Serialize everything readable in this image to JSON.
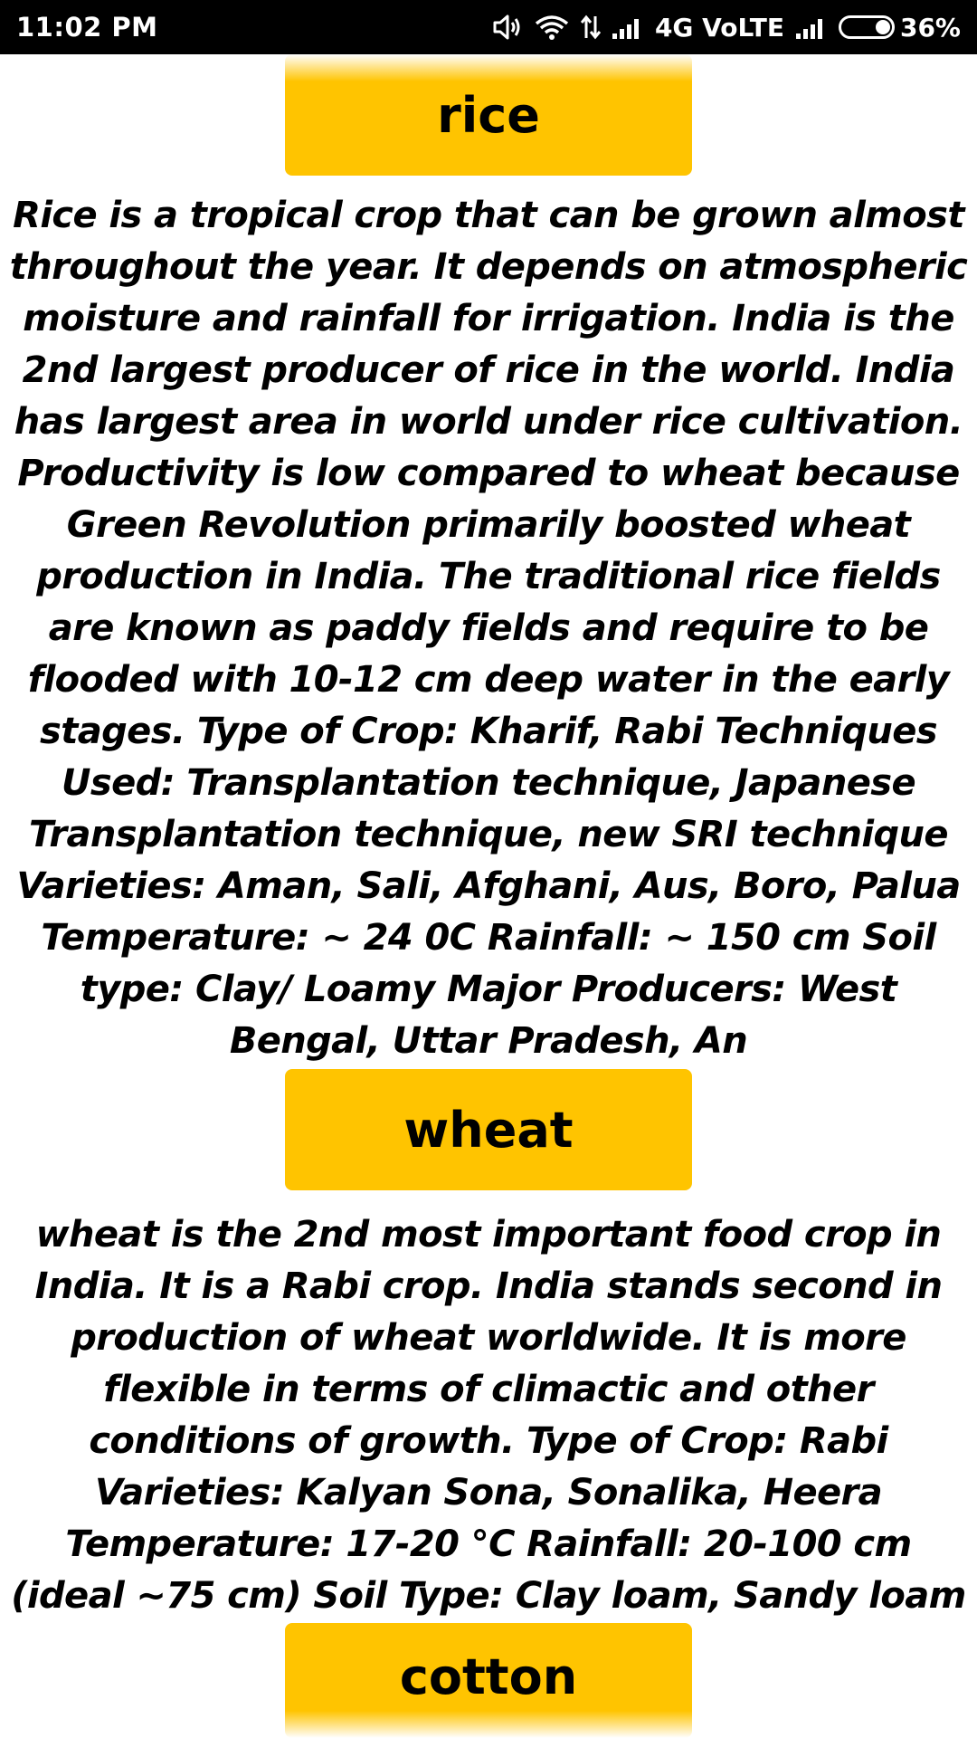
{
  "status_bar": {
    "time": "11:02 PM",
    "network_label": "4G VoLTE",
    "battery_percent": "36%",
    "icons": [
      "volume-icon",
      "wifi-icon",
      "data-activity-icon",
      "signal-icon",
      "signal-icon",
      "battery-icon"
    ]
  },
  "crops": [
    {
      "name": "rice",
      "description": "Rice is a tropical crop that can be grown almost throughout the year. It depends on atmospheric moisture and rainfall for irrigation. India is the 2nd largest producer of rice in the world. India has largest area in world under rice cultivation. Productivity is low compared to wheat because Green Revolution primarily boosted wheat production in India. The traditional rice fields are known as paddy fields and require to be flooded with 10-12 cm deep water in the early stages. Type of Crop: Kharif, Rabi Techniques Used: Transplantation technique, Japanese Transplantation technique, new SRI technique Varieties: Aman, Sali, Afghani, Aus, Boro, Palua Temperature: ~ 24 0C Rainfall: ~ 150 cm Soil type: Clay/ Loamy Major Producers: West Bengal, Uttar Pradesh, An"
    },
    {
      "name": "wheat",
      "description": "wheat  is the 2nd most important food crop in India. It is a Rabi crop. India stands second in production of wheat worldwide. It is more flexible in terms of climactic and other conditions of growth. Type of Crop: Rabi Varieties: Kalyan Sona, Sonalika, Heera Temperature: 17-20 °C Rainfall: 20-100 cm (ideal ~75 cm) Soil Type: Clay loam, Sandy loam"
    },
    {
      "name": "cotton",
      "description": ""
    }
  ],
  "colors": {
    "button_background": "#FFC400",
    "status_bar_background": "#000000",
    "page_background": "#FFFFFF",
    "text": "#000000"
  }
}
